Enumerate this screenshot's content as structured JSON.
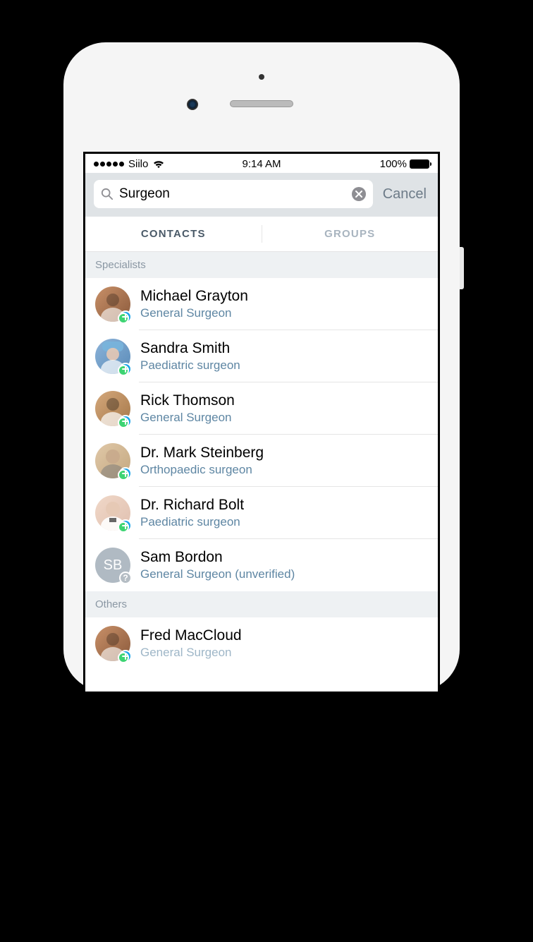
{
  "status_bar": {
    "carrier": "Siilo",
    "time": "9:14 AM",
    "battery_pct": "100%"
  },
  "search": {
    "query": "Surgeon",
    "cancel_label": "Cancel"
  },
  "tabs": {
    "contacts": "CONTACTS",
    "groups": "GROUPS"
  },
  "sections": [
    {
      "header": "Specialists",
      "items": [
        {
          "name": "Michael Grayton",
          "subtitle": "General Surgeon",
          "verified": true,
          "avatar_class": "av-1",
          "initials": ""
        },
        {
          "name": "Sandra Smith",
          "subtitle": "Paediatric surgeon",
          "verified": true,
          "avatar_class": "av-2",
          "initials": ""
        },
        {
          "name": "Rick Thomson",
          "subtitle": "General Surgeon",
          "verified": true,
          "avatar_class": "av-3",
          "initials": ""
        },
        {
          "name": "Dr. Mark Steinberg",
          "subtitle": "Orthopaedic surgeon",
          "verified": true,
          "avatar_class": "av-4",
          "initials": ""
        },
        {
          "name": "Dr. Richard Bolt",
          "subtitle": "Paediatric surgeon",
          "verified": true,
          "avatar_class": "av-5",
          "initials": ""
        },
        {
          "name": "Sam Bordon",
          "subtitle": "General Surgeon (unverified)",
          "verified": false,
          "avatar_class": "av-6",
          "initials": "SB"
        }
      ]
    },
    {
      "header": "Others",
      "items": [
        {
          "name": "Fred MacCloud",
          "subtitle": "General Surgeon",
          "verified": true,
          "avatar_class": "av-7",
          "initials": ""
        }
      ]
    }
  ]
}
